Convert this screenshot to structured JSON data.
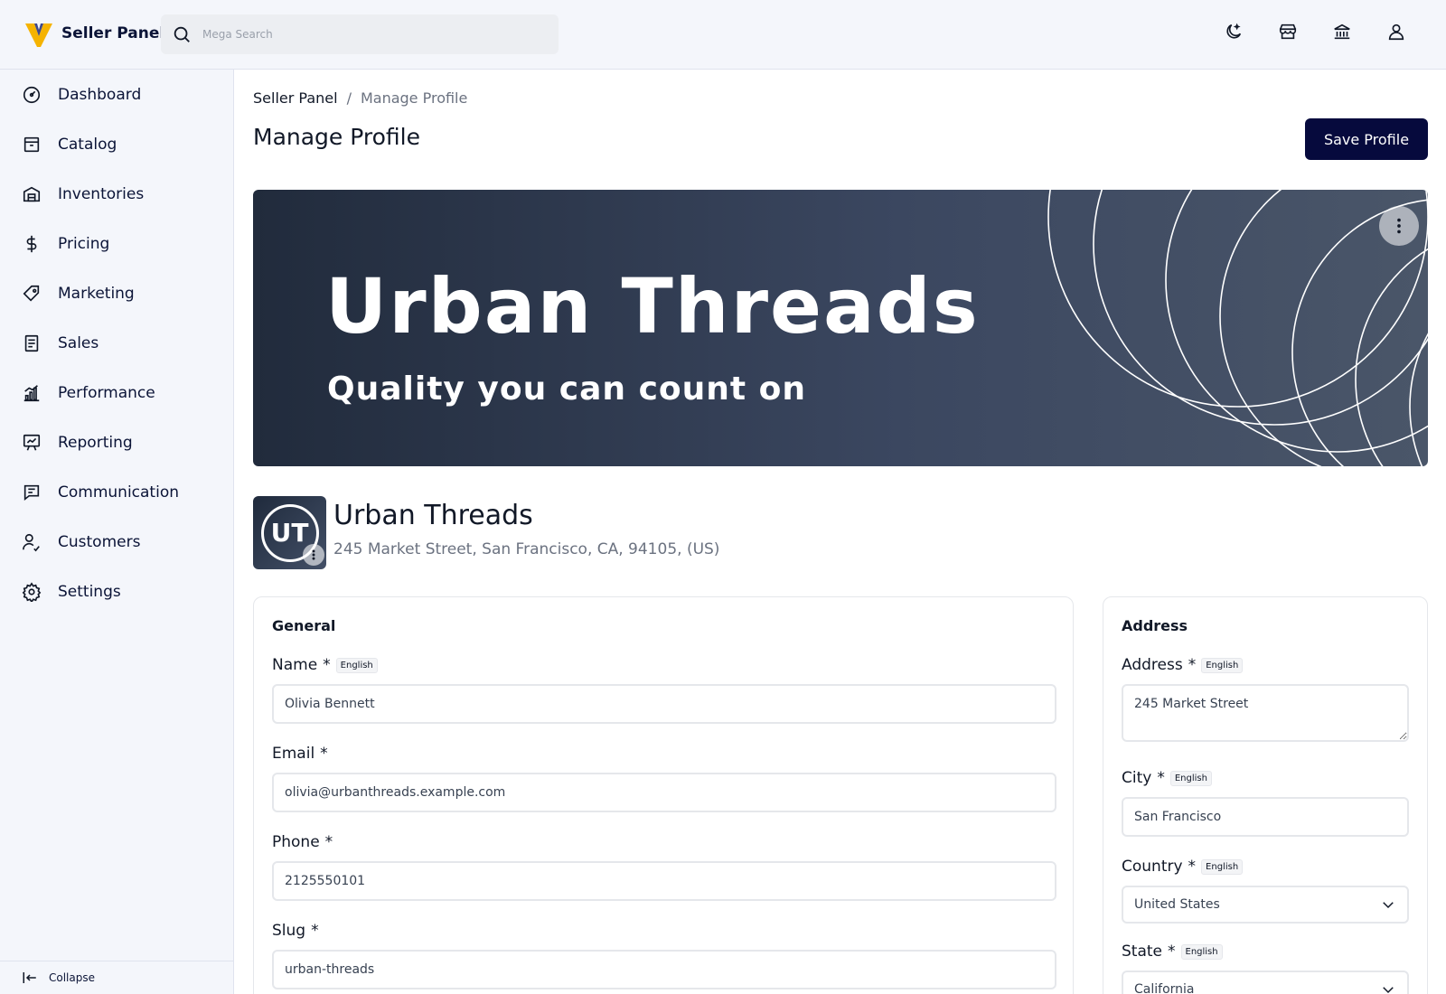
{
  "brand": {
    "name": "Seller Panel",
    "accent": "#f5b301"
  },
  "search": {
    "placeholder": "Mega Search"
  },
  "top_icons": [
    "moon-icon",
    "store-icon",
    "bank-icon",
    "user-icon"
  ],
  "sidebar": {
    "items": [
      {
        "label": "Dashboard",
        "icon": "gauge-icon"
      },
      {
        "label": "Catalog",
        "icon": "archive-box-icon"
      },
      {
        "label": "Inventories",
        "icon": "warehouse-icon"
      },
      {
        "label": "Pricing",
        "icon": "dollar-icon"
      },
      {
        "label": "Marketing",
        "icon": "tag-icon"
      },
      {
        "label": "Sales",
        "icon": "receipt-icon"
      },
      {
        "label": "Performance",
        "icon": "chart-bars-icon"
      },
      {
        "label": "Reporting",
        "icon": "presentation-icon"
      },
      {
        "label": "Communication",
        "icon": "chat-icon"
      },
      {
        "label": "Customers",
        "icon": "customers-icon"
      },
      {
        "label": "Settings",
        "icon": "gear-icon"
      }
    ],
    "collapse_label": "Collapse"
  },
  "breadcrumb": {
    "root": "Seller Panel",
    "separator": "/",
    "current": "Manage Profile"
  },
  "page": {
    "title": "Manage Profile",
    "save_label": "Save Profile"
  },
  "banner": {
    "title": "Urban Threads",
    "subtitle": "Quality you can count on"
  },
  "profile": {
    "initials": "UT",
    "name": "Urban Threads",
    "address": "245 Market Street, San Francisco, CA, 94105, (US)"
  },
  "general": {
    "title": "General",
    "name": {
      "label": "Name",
      "required": "*",
      "lang": "English",
      "value": "Olivia Bennett"
    },
    "email": {
      "label": "Email",
      "required": "*",
      "value": "olivia@urbanthreads.example.com"
    },
    "phone": {
      "label": "Phone",
      "required": "*",
      "value": "2125550101"
    },
    "slug": {
      "label": "Slug",
      "required": "*",
      "value": "urban-threads"
    }
  },
  "address": {
    "title": "Address",
    "address": {
      "label": "Address",
      "required": "*",
      "lang": "English",
      "value": "245 Market Street"
    },
    "city": {
      "label": "City",
      "required": "*",
      "lang": "English",
      "value": "San Francisco"
    },
    "country": {
      "label": "Country",
      "required": "*",
      "lang": "English",
      "value": "United States"
    },
    "state": {
      "label": "State",
      "required": "*",
      "lang": "English",
      "value": "California"
    }
  }
}
